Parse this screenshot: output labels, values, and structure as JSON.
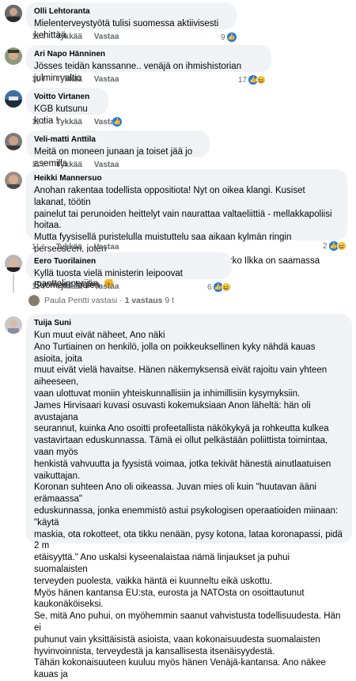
{
  "comments": [
    {
      "author": "Olli Lehtoranta",
      "text": "Mielenterveystyötä tulisi suomessa aktiivisesti kehittää.",
      "time": "11 t",
      "like": "Tykkää",
      "reply": "Vastaa",
      "reactions": "9"
    },
    {
      "author": "Ari Napo Hänninen",
      "text": "Jösses teidän kanssanne.. venäjä on ihmishistorian julmin valtio",
      "time": "11 t",
      "like": "Tykkää",
      "reply": "Vastaa",
      "reactions": "17"
    },
    {
      "author": "Voitto Virtanen",
      "text": "KGB kutsunu kotia !",
      "time": "11 t",
      "like": "Tykkää",
      "reply": "Vastaa",
      "reactions": ""
    },
    {
      "author": "Veli-matti Anttila",
      "text": "Meitä on moneen junaan ja toiset jää jo asemilla",
      "time": "11 t",
      "like": "Tykkää",
      "reply": "Vastaa",
      "reactions": ""
    },
    {
      "author": "Heikki Mannersuo",
      "text": "Anohan rakentaa todellista oppositiota! Nyt on oikea klangi. Kusiset lakanat, töötin\npainelut tai perunoiden heittelyt vain naurattaa valtaeliittiä - mellakkapoliisi hoitaa.\nMutta fyysisellä puristelulla muistuttelu saa aikaan kylmän ringin perseeseen, joten\nviranomaiset aloittavat satavarmasti vainon. Jaakko Ilkka on saamassa uudenajan\nmanttelinperijän. ✊",
      "time": "11 t",
      "like": "Tykkää",
      "reply": "Vastaa",
      "reactions": "2"
    },
    {
      "author": "Eero Tuorilainen",
      "text": "Kyllä tuosta vielä ministerin leipoovat Suomeen luulen",
      "time": "11 t",
      "like": "Tykkää",
      "reply": "Vastaa",
      "reactions": "6"
    },
    {
      "author": "Tuija Suni",
      "text": "Kun muut eivät näheet, Ano näki\nAno Turtiainen on henkilö, jolla on poikkeuksellinen kyky nähdä kauas asioita, joita\nmuut eivät vielä havaitse. Hänen näkemyksensä eivät rajoitu vain yhteen aiheeseen,\nvaan ulottuvat moniin yhteiskunnallisiin ja inhimillisiin kysymyksiin.\nJames Hirvisaari kuvasi osuvasti kokemuksiaan Anon läheltä: hän oli avustajana\nseurannut, kuinka Ano osoitti profeetallista näkökykyä ja rohkeutta kulkea\nvastavirtaan eduskunnassa. Tämä ei ollut pelkästään poliittista toimintaa, vaan myös\nhenkistä vahvuutta ja fyysistä voimaa, jotka tekivät hänestä ainutlaatuisen\nvaikuttajan.\nKoronan suhteen Ano oli oikeassa. Juvan mies oli kuin \"huutavan ääni erämaassa\"\neduskunnassa, jonka enemmistö astui psykologisen operaatioiden miinaan: \"käytä\nmaskia, ota rokotteet, ota tikku nenään, pysy kotona, lataa koronapassi, pidä 2 m\netäisyyttä.\" Ano uskalsi kyseenalaistaa nämä linjaukset ja puhui suomalaisten\nterveyden puolesta, vaikka häntä ei kuunneltu eikä uskottu.\nMyös hänen kantansa EU:sta, eurosta ja NATOsta on osoittautunut kaukonäköiseksi.\nSe, mitä Ano puhui, on myöhemmin saanut vahvistusta todellisuudesta. Hän ei\npuhunut vain yksittäisistä asioista, vaan kokonaisuudesta suomalaisten\nhyvinvoinnista, terveydestä ja kansallisesta itsenäisyydestä.\nTähän kokonaisuuteen kuuluu myös hänen Venäjä-kantansa. Ano näkee kauas ja"
    }
  ],
  "reply_thread": {
    "name": "Paula Pentti",
    "suffix": "vastasi",
    "separator": "·",
    "count": "1 vastaus",
    "time": "9 t"
  },
  "colors": {
    "bubble": "#f0f2f5",
    "like_blue": "#1877f2",
    "meta": "#65676b"
  }
}
